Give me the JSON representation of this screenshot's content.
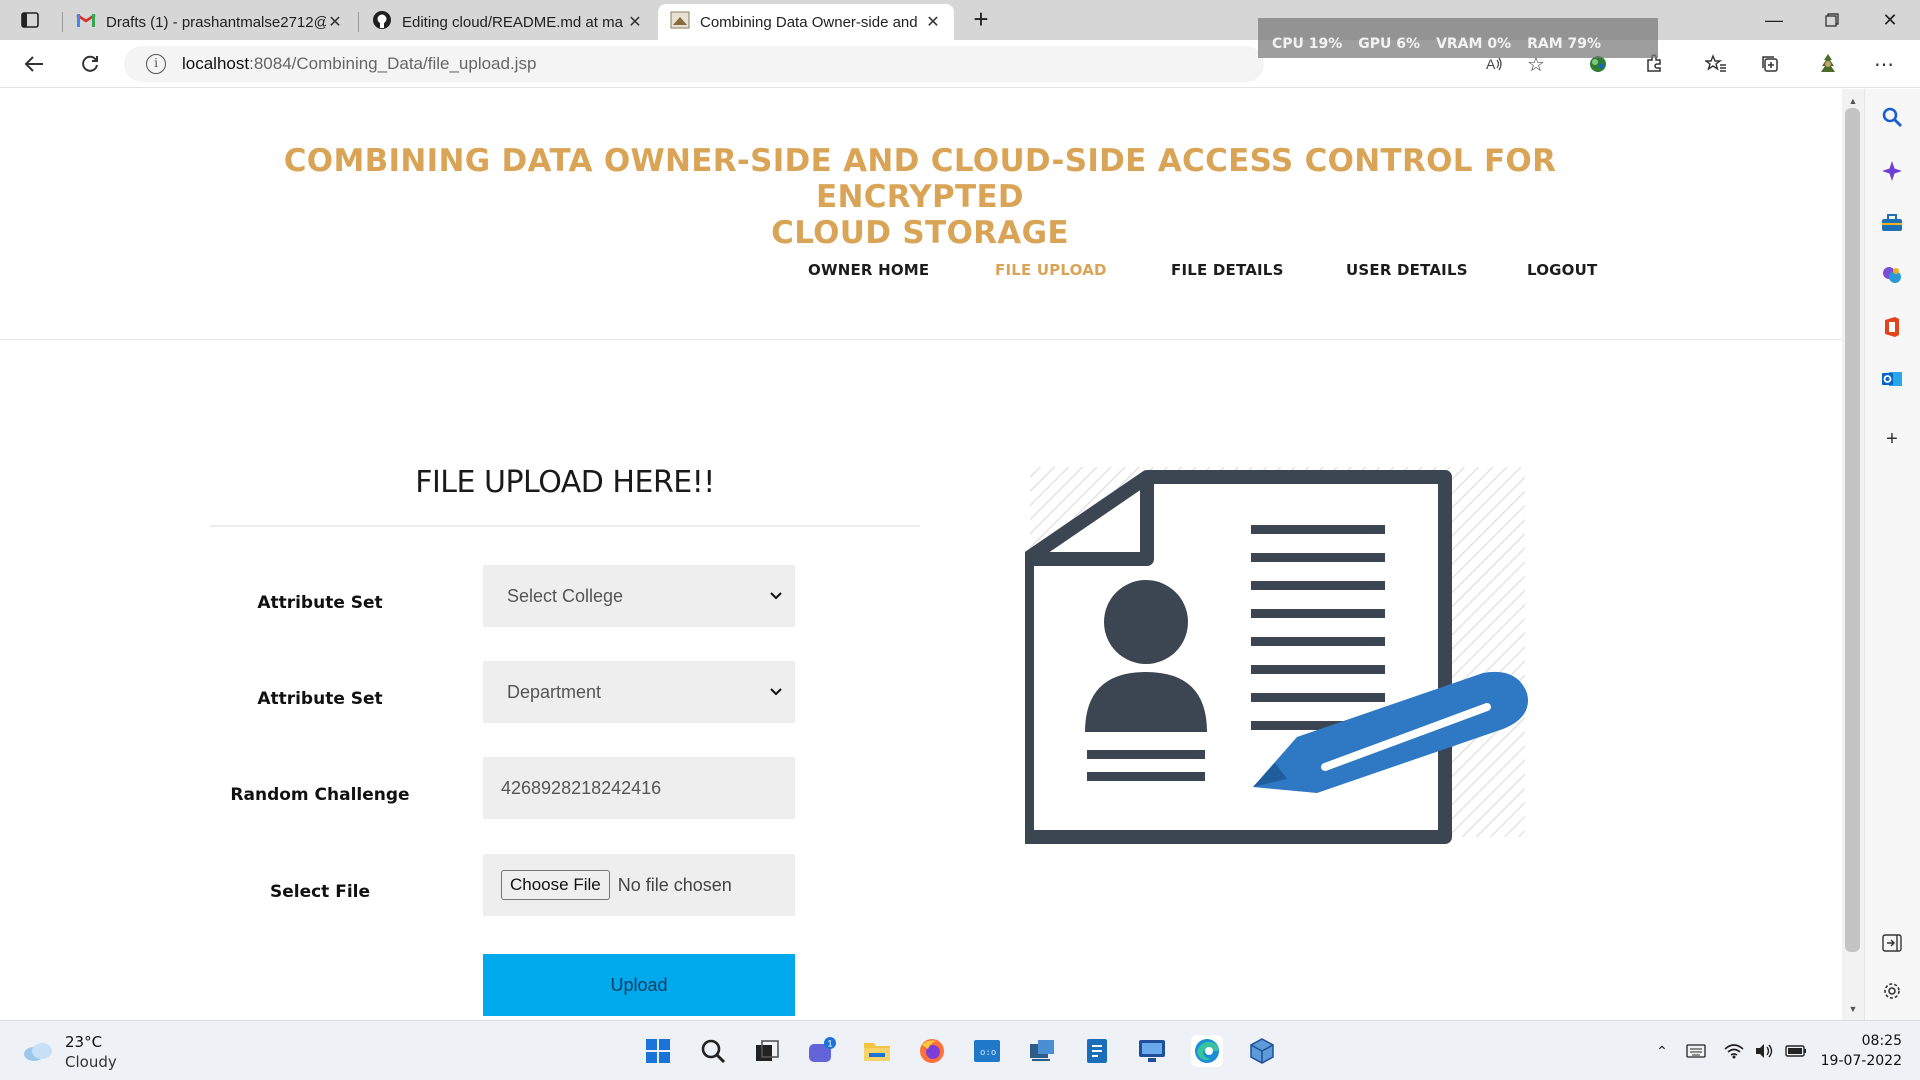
{
  "browser": {
    "tabs": [
      {
        "title": "Drafts (1) - prashantmalse2712@",
        "icon": "gmail-icon"
      },
      {
        "title": "Editing cloud/README.md at ma",
        "icon": "github-icon"
      },
      {
        "title": "Combining Data Owner-side and",
        "icon": "site-favicon"
      }
    ],
    "address": {
      "host": "localhost",
      "path": ":8084/Combining_Data/file_upload.jsp"
    },
    "perf": {
      "cpu": "CPU  19%",
      "gpu": "GPU   6%",
      "vram": "VRAM   0%",
      "ram": "RAM  79%"
    }
  },
  "site": {
    "title_line1": "COMBINING DATA OWNER-SIDE AND CLOUD-SIDE ACCESS CONTROL FOR ENCRYPTED",
    "title_line2": "CLOUD STORAGE",
    "nav": [
      "OWNER HOME",
      "FILE UPLOAD",
      "FILE DETAILS",
      "USER DETAILS",
      "LOGOUT"
    ],
    "active_nav": "FILE UPLOAD",
    "accent_color": "#d9a456"
  },
  "form": {
    "heading": "FILE UPLOAD HERE!!",
    "attribute_label_1": "Attribute Set",
    "college_select": "Select College",
    "attribute_label_2": "Attribute Set",
    "department_select": "Department",
    "challenge_label": "Random Challenge",
    "challenge_value": "4268928218242416",
    "file_label": "Select File",
    "choose_file": "Choose File",
    "no_file": "No file chosen",
    "upload_button": "Upload",
    "upload_color": "#00a8ec"
  },
  "taskbar": {
    "weather_temp": "23°C",
    "weather_condition": "Cloudy",
    "chat_badge": "1",
    "time": "08:25",
    "date": "19-07-2022"
  }
}
